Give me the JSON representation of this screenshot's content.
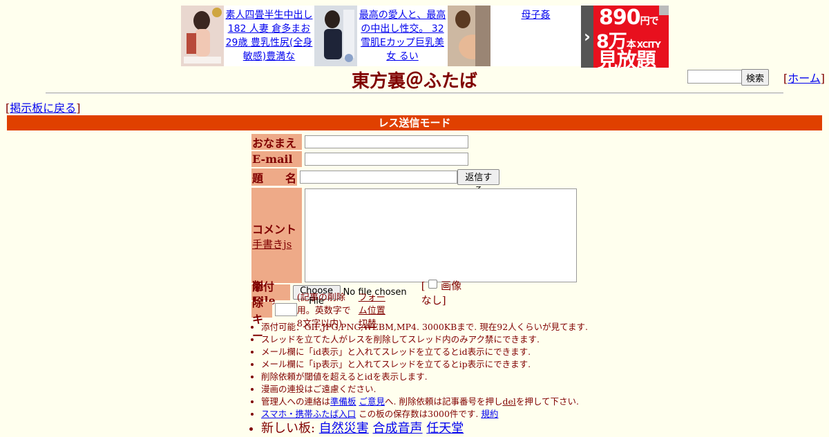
{
  "ads": [
    {
      "text": "素人四畳半生中出し182 人妻 倉多まお 29歳 豊乳性尻(全身敏感)豊満な"
    },
    {
      "text": "最高の愛人と、最高の中出し性交。 32 雪肌Eカップ巨乳美女 るい"
    },
    {
      "text": "母子姦"
    }
  ],
  "banner": {
    "price": "890",
    "price_unit": "円で",
    "count": "8万",
    "count_unit": "本",
    "brand": "XCITY",
    "tagline": "見放題"
  },
  "header": {
    "title": "東方裏＠ふたば",
    "search_button": "検索",
    "home_label": "ホーム",
    "back_label": "掲示板に戻る"
  },
  "mode_bar": "レス送信モード",
  "form": {
    "name_label": "おなまえ",
    "email_label": "E-mail",
    "subject_label": "題　　名",
    "submit_button": "返信する",
    "comment_label": "コメント",
    "handwrite_link": "手書きjs",
    "file_label": "添付File",
    "file_button": "Choose File",
    "file_status": "No file chosen",
    "no_image_label": "画像なし",
    "delkey_label": "削除キー",
    "delkey_note": "(記事の削除用。英数字で8文字以内)",
    "form_toggle_link": "フォーム位置切替"
  },
  "rules": {
    "r1": "添付可能：GIF,JPG,PNG,WEBM,MP4. 3000KBまで. 現在92人くらいが見てます.",
    "r2": "スレッドを立てた人がレスを削除してスレッド内のみアク禁にできます.",
    "r3": "メール欄に「id表示」と入れてスレッドを立てるとid表示にできます.",
    "r4": "メール欄に「ip表示」と入れてスレッドを立てるとip表示にできます.",
    "r5": "削除依頼が閾値を超えるとidを表示します.",
    "r6": "漫画の連投はご遠慮ください.",
    "r7_pre": "管理人への連絡は",
    "r7_link1": "準備板",
    "r7_link2": "ご意見",
    "r7_mid": "へ. 削除依頼は記事番号を押し",
    "r7_link3": "del",
    "r7_post": "を押して下さい.",
    "r8_link": "スマホ・携帯ふたば入口",
    "r8_mid": " この板の保存数は3000件です. ",
    "r8_link2": "規約",
    "r9_pre": "新しい板: ",
    "r9_link1": "自然災害",
    "r9_link2": "合成音声",
    "r9_link3": "任天堂"
  },
  "colors": {
    "background": "#ffffee",
    "text": "#800000",
    "mode_bar": "#e04000",
    "label_bg": "#eeaa88",
    "link": "#0000ee"
  }
}
